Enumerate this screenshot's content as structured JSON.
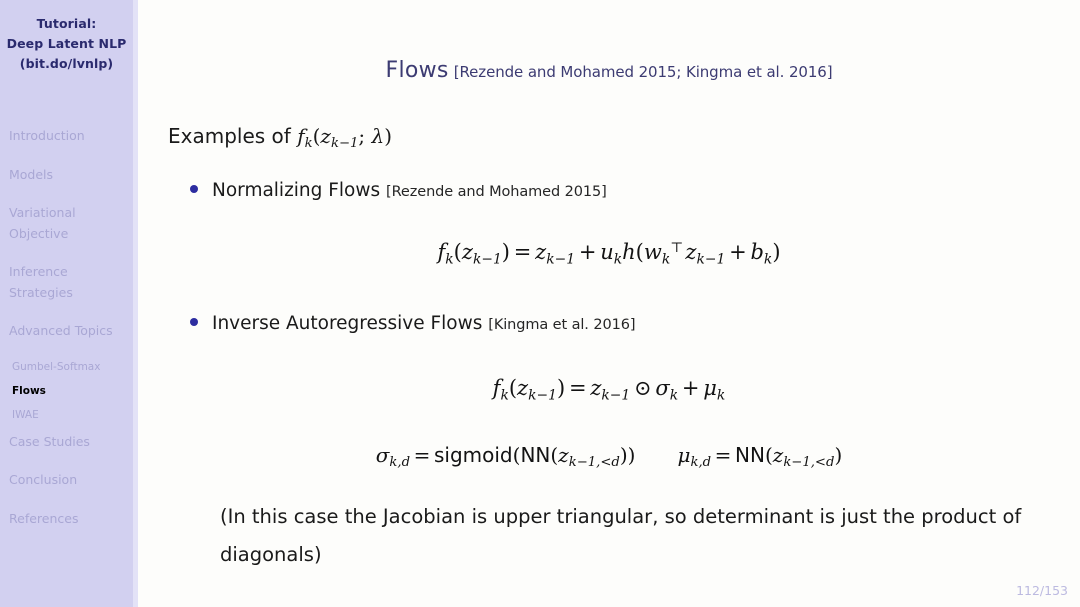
{
  "sidebar": {
    "title_lines": [
      "Tutorial:",
      "Deep Latent NLP",
      "(bit.do/lvnlp)"
    ],
    "items": [
      {
        "label": "Introduction",
        "level": "top",
        "active": false
      },
      {
        "label": "Models",
        "level": "top",
        "active": false
      },
      {
        "label": "Variational Objective",
        "level": "top",
        "active": false
      },
      {
        "label": "Inference Strategies",
        "level": "top",
        "active": false
      },
      {
        "label": "Advanced Topics",
        "level": "top",
        "active": false
      },
      {
        "label": "Gumbel-Softmax",
        "level": "sub",
        "active": false
      },
      {
        "label": "Flows",
        "level": "sub",
        "active": true
      },
      {
        "label": "IWAE",
        "level": "sub",
        "active": false
      },
      {
        "label": "Case Studies",
        "level": "top",
        "active": false
      },
      {
        "label": "Conclusion",
        "level": "top",
        "active": false
      },
      {
        "label": "References",
        "level": "top",
        "active": false
      }
    ]
  },
  "slide": {
    "title": "Flows",
    "title_citation": "[Rezende and Mohamed 2015; Kingma et al. 2016]",
    "examples_prefix": "Examples of",
    "examples_math": "f_k(z_{k-1}; λ)",
    "bullets": [
      {
        "label": "Normalizing Flows",
        "citation": "[Rezende and Mohamed 2015]",
        "equation": "f_k(z_{k-1}) = z_{k-1} + u_k h(w_k^T z_{k-1} + b_k)"
      },
      {
        "label": "Inverse Autoregressive Flows",
        "citation": "[Kingma et al. 2016]",
        "equation": "f_k(z_{k-1}) = z_{k-1} ⊙ σ_k + μ_k",
        "equation_2_left": "σ_{k,d} = sigmoid(NN(z_{k-1,<d}))",
        "equation_2_right": "μ_{k,d} = NN(z_{k-1,<d})"
      }
    ],
    "note": "(In this case the Jacobian is upper triangular, so determinant is just the product of diagonals)",
    "page_number": "112/153"
  },
  "colors": {
    "sidebar_bg": "#d2d0f0",
    "sidebar_edge": "#e3e2f7",
    "sidebar_title": "#2a2a6e",
    "sidebar_muted": "#a9a7d4",
    "sidebar_active": "#000000",
    "title_blue": "#3c3b72",
    "bullet_dot": "#2d2da0",
    "body_text": "#1a1a1a",
    "page_number": "#bcbae0",
    "main_bg": "#fdfdfb"
  }
}
